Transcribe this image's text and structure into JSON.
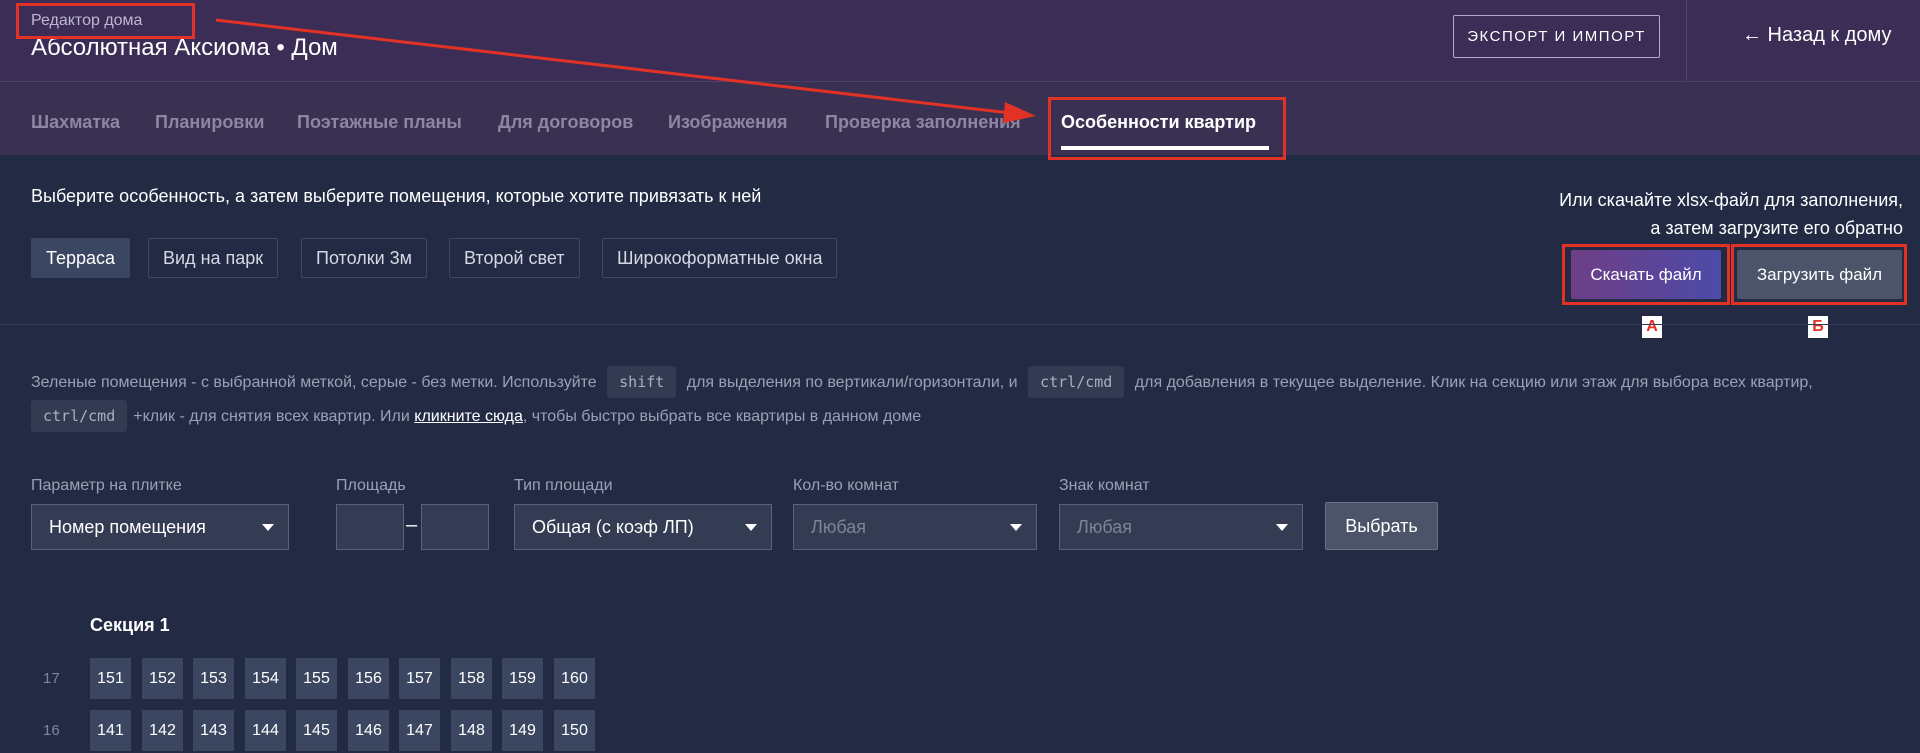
{
  "header": {
    "subtitle": "Редактор дома",
    "title": "Абсолютная Аксиома • Дом",
    "export_label": "ЭКСПОРТ И ИМПОРТ",
    "back_label": "← Назад к дому"
  },
  "tabs": [
    {
      "label": "Шахматка"
    },
    {
      "label": "Планировки"
    },
    {
      "label": "Поэтажные планы"
    },
    {
      "label": "Для договоров"
    },
    {
      "label": "Изображения"
    },
    {
      "label": "Проверка заполнения"
    },
    {
      "label": "Особенности квартир"
    }
  ],
  "instruction": "Выберите особенность, а затем выберите помещения, которые хотите привязать к ней",
  "features": [
    {
      "label": "Терраса"
    },
    {
      "label": "Вид на парк"
    },
    {
      "label": "Потолки 3м"
    },
    {
      "label": "Второй свет"
    },
    {
      "label": "Широкоформатные окна"
    }
  ],
  "xlsx": {
    "hint_line1": "Или скачайте xlsx-файл для заполнения,",
    "hint_line2": "а затем загрузите его обратно",
    "download_label": "Скачать файл",
    "upload_label": "Загрузить файл"
  },
  "annotations": {
    "a": "А",
    "b": "Б"
  },
  "help": {
    "part1": "Зеленые помещения - с выбранной меткой, серые - без метки. Используйте",
    "key_shift": "shift",
    "part2": "для выделения по вертикали/горизонтали, и",
    "key_ctrl": "ctrl/cmd",
    "part3": "для добавления в текущее выделение. Клик на секцию или этаж для выбора всех квартир,",
    "key_ctrl2": "ctrl/cmd",
    "part4": "+клик - для снятия всех квартир. Или",
    "link": "кликните сюда",
    "part5": ", чтобы быстро выбрать все квартиры в данном доме"
  },
  "filters": {
    "tile_param_label": "Параметр на плитке",
    "tile_param_value": "Номер помещения",
    "area_label": "Площадь",
    "area_type_label": "Тип площади",
    "area_type_value": "Общая (с коэф ЛП)",
    "rooms_label": "Кол-во комнат",
    "rooms_value": "Любая",
    "rooms_sign_label": "Знак комнат",
    "rooms_sign_value": "Любая",
    "choose_label": "Выбрать"
  },
  "grid": {
    "section_title": "Секция 1",
    "floors": [
      {
        "floor": "17",
        "apartments": [
          "151",
          "152",
          "153",
          "154",
          "155",
          "156",
          "157",
          "158",
          "159",
          "160"
        ]
      },
      {
        "floor": "16",
        "apartments": [
          "141",
          "142",
          "143",
          "144",
          "145",
          "146",
          "147",
          "148",
          "149",
          "150"
        ]
      }
    ]
  },
  "colors": {
    "annotation_red": "#e23225",
    "header_bg": "#3b2d56",
    "page_bg": "#232b44"
  }
}
